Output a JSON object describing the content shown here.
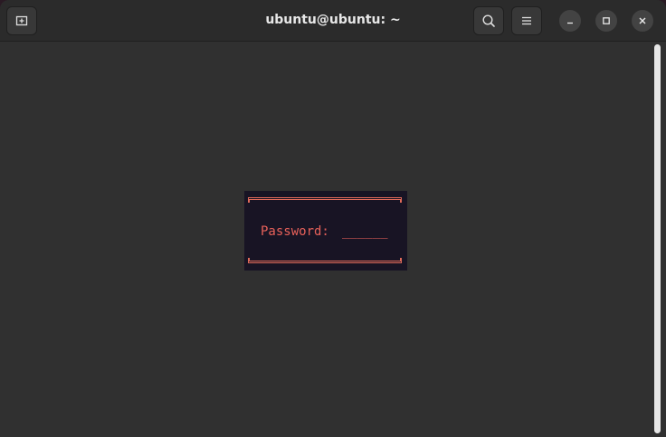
{
  "window": {
    "title": "ubuntu@ubuntu: ~",
    "buttons": {
      "new_tab_icon": "new-tab-icon",
      "search_icon": "search-icon",
      "menu_icon": "hamburger-menu-icon",
      "minimize_icon": "minimize-icon",
      "maximize_icon": "maximize-icon",
      "close_icon": "close-icon"
    }
  },
  "terminal": {
    "dialog": {
      "prompt_label": "Password:",
      "input_value": "______"
    }
  },
  "colors": {
    "terminal_bg": "#303030",
    "titlebar_bg": "#2b2b2b",
    "dialog_bg": "#181424",
    "dialog_accent": "#e8615a",
    "title_text": "#e8e8e8"
  }
}
